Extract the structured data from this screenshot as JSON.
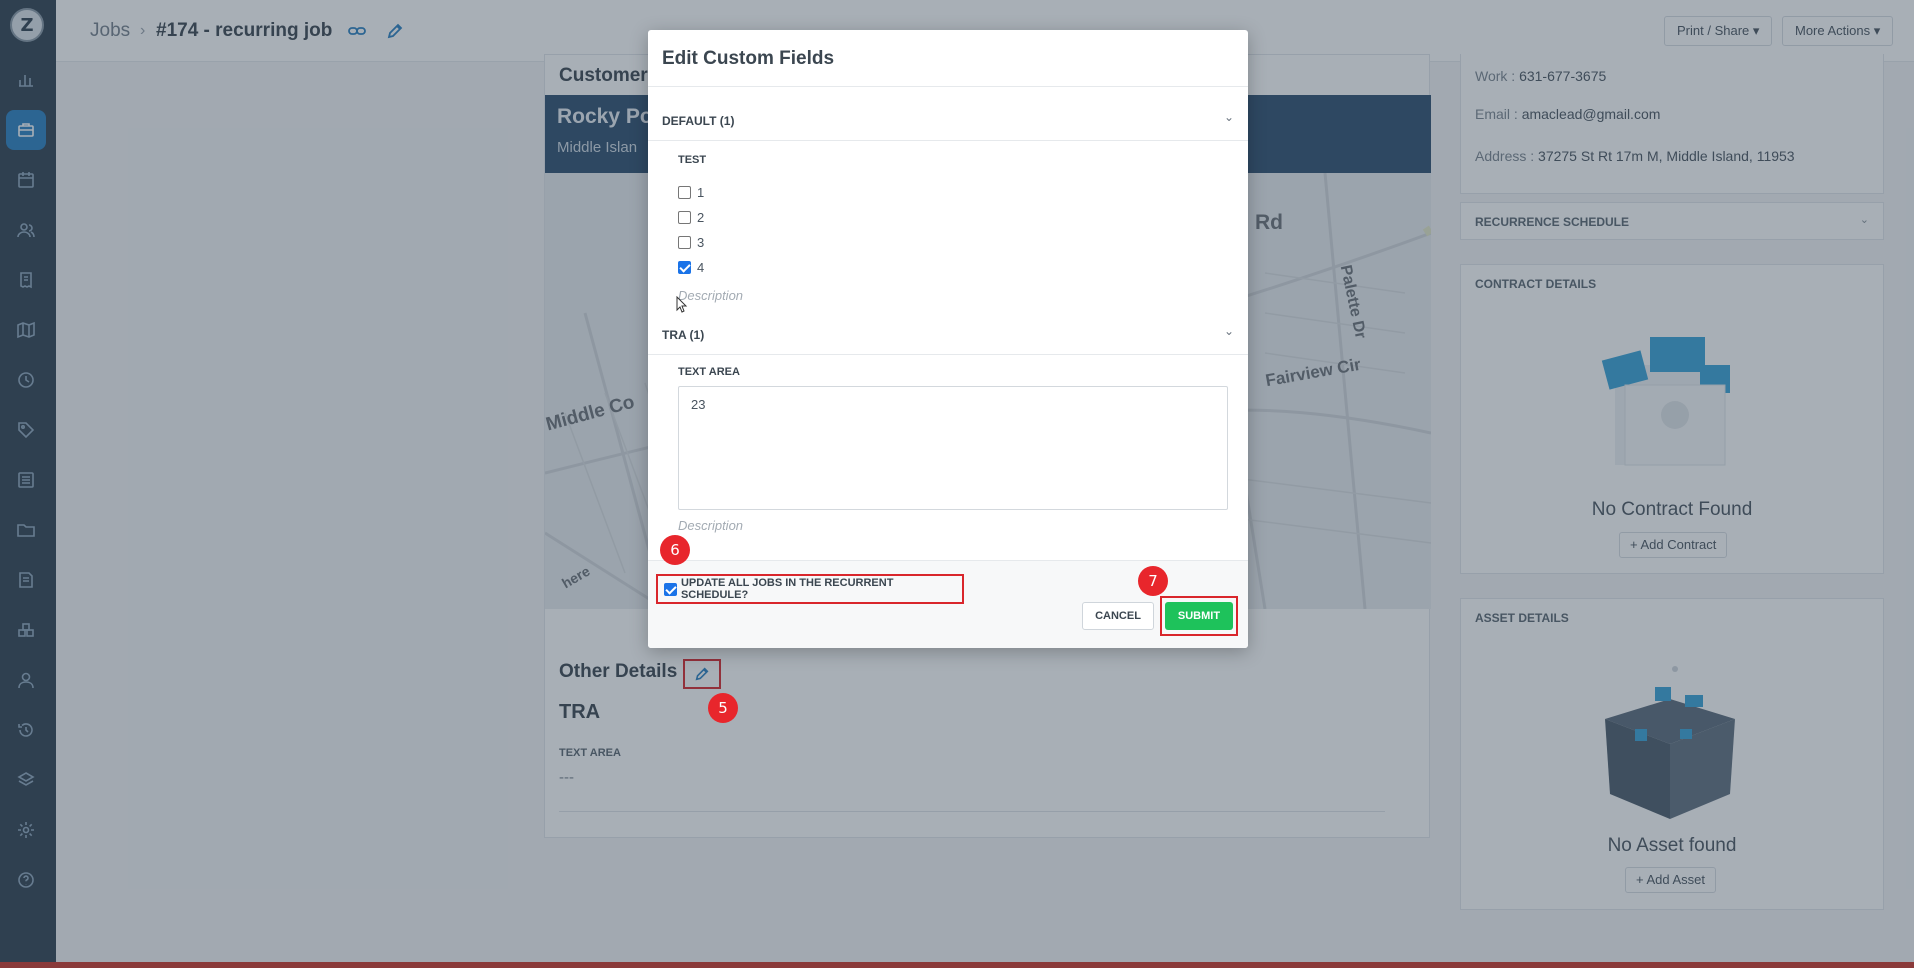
{
  "colors": {
    "sidebar": "#2f4050",
    "accent": "#2a80c2",
    "submit": "#1ec25b",
    "highlight": "#d9262c",
    "overlay": "rgba(47,64,80,0.42)"
  },
  "sidebar": {
    "logo_text": "Z",
    "items": [
      {
        "icon": "bar-chart-icon"
      },
      {
        "icon": "briefcase-icon",
        "active": true
      },
      {
        "icon": "calendar-icon"
      },
      {
        "icon": "users-icon"
      },
      {
        "icon": "receipt-icon"
      },
      {
        "icon": "map-icon"
      },
      {
        "icon": "clock-icon"
      },
      {
        "icon": "tag-icon"
      },
      {
        "icon": "list-icon"
      },
      {
        "icon": "folder-icon"
      },
      {
        "icon": "book-icon"
      },
      {
        "icon": "cubes-icon"
      },
      {
        "icon": "user-icon"
      },
      {
        "icon": "history-icon"
      },
      {
        "icon": "layers-icon"
      },
      {
        "icon": "gear-icon"
      },
      {
        "icon": "help-icon"
      }
    ]
  },
  "topbar": {
    "breadcrumb_root": "Jobs",
    "breadcrumb_sep": "›",
    "job_title": "#174 - recurring job",
    "print_share": "Print / Share",
    "more_actions": "More Actions"
  },
  "customer": {
    "section_title": "Customer",
    "name": "Rocky Poi",
    "location": "Middle Islan",
    "map_labels": [
      "Rd",
      "Palette Dr",
      "Fairview Cir",
      "Middle Co",
      "here"
    ]
  },
  "other_details": {
    "title": "Other Details",
    "group": "TRA",
    "field_label": "TEXT AREA",
    "field_value": "---"
  },
  "contact": {
    "work_label": "Work : ",
    "work_value": "631-677-3675",
    "email_label": "Email : ",
    "email_value": "amaclead@gmail.com",
    "address_label": "Address : ",
    "address_value": "37275 St Rt 17m M, Middle Island, 11953"
  },
  "recurrence": {
    "title": "RECURRENCE SCHEDULE"
  },
  "contract": {
    "title": "CONTRACT DETAILS",
    "empty": "No Contract Found",
    "add": "+ Add Contract"
  },
  "asset": {
    "title": "ASSET DETAILS",
    "empty": "No Asset found",
    "add": "+ Add Asset"
  },
  "modal": {
    "title": "Edit Custom Fields",
    "groups": [
      {
        "title": "DEFAULT (1)",
        "field_label": "TEST",
        "options": [
          {
            "label": "1",
            "checked": false
          },
          {
            "label": "2",
            "checked": false
          },
          {
            "label": "3",
            "checked": false
          },
          {
            "label": "4",
            "checked": true
          }
        ],
        "description_placeholder": "Description"
      },
      {
        "title": "TRA (1)",
        "field_label": "TEXT AREA",
        "value": "23",
        "description_placeholder": "Description"
      }
    ],
    "update_all_label": "UPDATE ALL JOBS IN THE RECURRENT SCHEDULE?",
    "update_all_checked": true,
    "cancel": "CANCEL",
    "submit": "SUBMIT"
  },
  "step_badges": [
    "5",
    "6",
    "7"
  ]
}
